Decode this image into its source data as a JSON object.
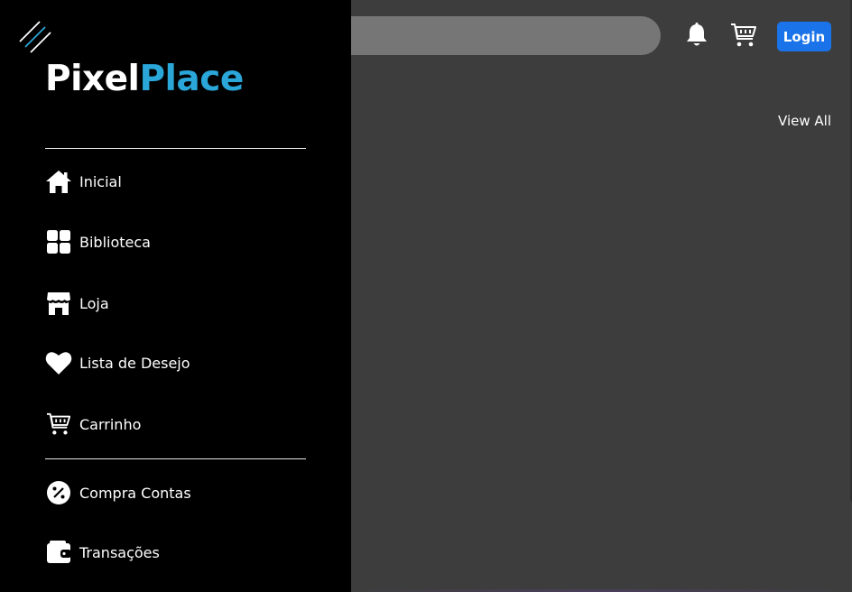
{
  "header": {
    "search_placeholder": "",
    "login_label": "Login",
    "notification_icon": "bell-icon",
    "cart_icon": "cart-icon"
  },
  "main": {
    "view_all_label": "View All"
  },
  "sidebar": {
    "logo_part1": "Pixel",
    "logo_part2": "Place",
    "items": [
      {
        "label": "Inicial",
        "icon": "home-icon"
      },
      {
        "label": "Biblioteca",
        "icon": "grid-icon"
      },
      {
        "label": "Loja",
        "icon": "store-icon"
      },
      {
        "label": "Lista de Desejo",
        "icon": "heart-icon"
      },
      {
        "label": "Carrinho",
        "icon": "cart-icon"
      },
      {
        "label": "Compra Contas",
        "icon": "discount-icon"
      },
      {
        "label": "Transações",
        "icon": "wallet-icon"
      }
    ]
  },
  "colors": {
    "accent": "#2aa6d8",
    "login_button": "#1a73e8",
    "sidebar_bg": "#000000",
    "main_bg": "#3d3d3d",
    "search_bg": "#767676"
  }
}
